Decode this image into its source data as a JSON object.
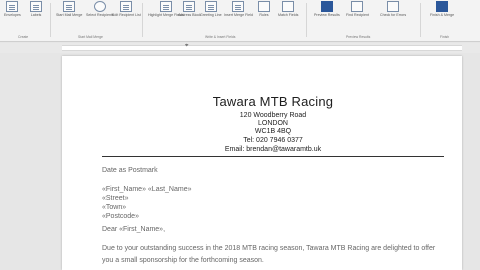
{
  "ribbon": {
    "groups": [
      {
        "label": "Create"
      },
      {
        "label": "Start Mail Merge"
      },
      {
        "label": "Write & Insert Fields"
      },
      {
        "label": "Preview Results"
      },
      {
        "label": "Finish"
      }
    ],
    "buttons": [
      {
        "label": "Envelopes"
      },
      {
        "label": "Labels"
      },
      {
        "label": "Start Mail Merge"
      },
      {
        "label": "Select Recipients"
      },
      {
        "label": "Edit Recipient List"
      },
      {
        "label": "Highlight Merge Fields"
      },
      {
        "label": "Address Block"
      },
      {
        "label": "Greeting Line"
      },
      {
        "label": "Insert Merge Field"
      },
      {
        "label": "Rules"
      },
      {
        "label": "Match Fields"
      },
      {
        "label": "Update Labels"
      },
      {
        "label": "Preview Results"
      },
      {
        "label": "Find Recipient"
      },
      {
        "label": "Check for Errors"
      },
      {
        "label": "Finish & Merge"
      }
    ]
  },
  "ruler": {
    "marker": "⌖"
  },
  "letter": {
    "company": "Tawara MTB Racing",
    "address_lines": [
      "120 Woodberry Road",
      "LONDON",
      "WC1B 4BQ",
      "Tel: 020 7946 0377",
      "Email: brendan@tawaramtb.uk"
    ],
    "date_line": "Date as Postmark",
    "recipient_lines": [
      "«First_Name» «Last_Name»",
      "«Street»",
      "«Town»",
      "«Postcode»"
    ],
    "salutation": "Dear «First_Name»,",
    "body": "Due to your outstanding success in the 2018 MTB racing season, Tawara MTB Racing are delighted to offer you a small sponsorship for the forthcoming season."
  }
}
